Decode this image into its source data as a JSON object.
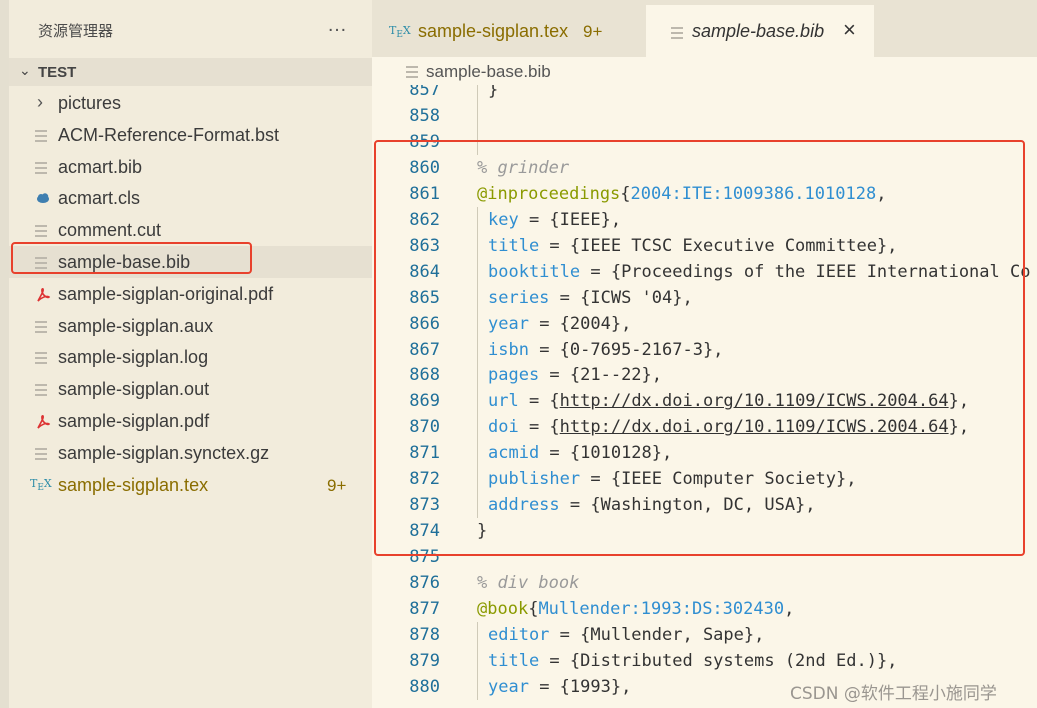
{
  "sidebar": {
    "title": "资源管理器",
    "more_icon": "…",
    "section_title": "TEST",
    "items": [
      {
        "label": "pictures",
        "icon": "chevron-right-icon",
        "type": "folder"
      },
      {
        "label": "ACM-Reference-Format.bst",
        "icon": "document-icon"
      },
      {
        "label": "acmart.bib",
        "icon": "document-icon"
      },
      {
        "label": "acmart.cls",
        "icon": "cloud-icon"
      },
      {
        "label": "comment.cut",
        "icon": "document-icon"
      },
      {
        "label": "sample-base.bib",
        "icon": "document-icon",
        "selected": true
      },
      {
        "label": "sample-sigplan-original.pdf",
        "icon": "pdf-icon"
      },
      {
        "label": "sample-sigplan.aux",
        "icon": "document-icon"
      },
      {
        "label": "sample-sigplan.log",
        "icon": "document-icon"
      },
      {
        "label": "sample-sigplan.out",
        "icon": "document-icon"
      },
      {
        "label": "sample-sigplan.pdf",
        "icon": "pdf-icon"
      },
      {
        "label": "sample-sigplan.synctex.gz",
        "icon": "document-icon"
      },
      {
        "label": "sample-sigplan.tex",
        "icon": "tex-icon",
        "badge": "9+"
      }
    ]
  },
  "tabs": [
    {
      "label": "sample-sigplan.tex",
      "badge": "9+",
      "icon": "tex-icon"
    },
    {
      "label": "sample-base.bib",
      "icon": "document-icon",
      "close": "×"
    }
  ],
  "breadcrumb": {
    "label": "sample-base.bib"
  },
  "code_lines": [
    {
      "n": "857",
      "text": "}",
      "kind": "brace"
    },
    {
      "n": "858",
      "text": ""
    },
    {
      "n": "859",
      "text": ""
    },
    {
      "n": "860",
      "text": "% grinder",
      "kind": "comment"
    },
    {
      "n": "861",
      "entry": "@inproceedings",
      "key": "2004:ITE:1009386.1010128",
      "kind": "entry"
    },
    {
      "n": "862",
      "field": "key",
      "value": " = {IEEE},",
      "kind": "field"
    },
    {
      "n": "863",
      "field": "title",
      "value": " = {IEEE TCSC Executive Committee},",
      "kind": "field"
    },
    {
      "n": "864",
      "field": "booktitle",
      "value": " = {Proceedings of the IEEE International Co",
      "kind": "field"
    },
    {
      "n": "865",
      "field": "series",
      "value": " = {ICWS '04},",
      "kind": "field"
    },
    {
      "n": "866",
      "field": "year",
      "value": " = {2004},",
      "kind": "field"
    },
    {
      "n": "867",
      "field": "isbn",
      "value": " = {0-7695-2167-3},",
      "kind": "field"
    },
    {
      "n": "868",
      "field": "pages",
      "value": " = {21--22},",
      "kind": "field"
    },
    {
      "n": "869",
      "field": "url",
      "pre": " = {",
      "url": "http://dx.doi.org/10.1109/ICWS.2004.64",
      "post": "},",
      "kind": "urlfield"
    },
    {
      "n": "870",
      "field": "doi",
      "pre": " = {",
      "url": "http://dx.doi.org/10.1109/ICWS.2004.64",
      "post": "},",
      "kind": "urlfield"
    },
    {
      "n": "871",
      "field": "acmid",
      "value": " = {1010128},",
      "kind": "field"
    },
    {
      "n": "872",
      "field": "publisher",
      "value": " = {IEEE Computer Society},",
      "kind": "field"
    },
    {
      "n": "873",
      "field": "address",
      "value": " = {Washington, DC, USA},",
      "kind": "field"
    },
    {
      "n": "874",
      "text": "}",
      "kind": "brace"
    },
    {
      "n": "875",
      "text": ""
    },
    {
      "n": "876",
      "text": "% div book",
      "kind": "comment"
    },
    {
      "n": "877",
      "entry": "@book",
      "key": "Mullender:1993:DS:302430",
      "kind": "entry"
    },
    {
      "n": "878",
      "field": "editor",
      "value": " = {Mullender, Sape},",
      "kind": "field"
    },
    {
      "n": "879",
      "field": "title",
      "value": " = {Distributed systems (2nd Ed.)},",
      "kind": "field"
    },
    {
      "n": "880",
      "field": "year",
      "value": " = {1993},",
      "kind": "field"
    }
  ],
  "watermark": "CSDN @软件工程小施同学",
  "colors": {
    "highlight": "#e8412c",
    "tex": "#8a6d00",
    "field": "#2f8ed1",
    "entry": "#8a9a00"
  }
}
